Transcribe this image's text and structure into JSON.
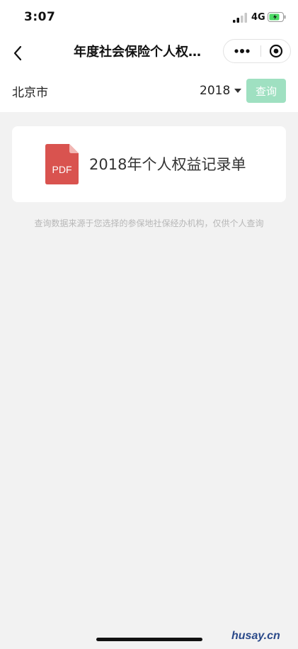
{
  "status_bar": {
    "time": "3:07",
    "network": "4G",
    "battery_color": "#4cd964"
  },
  "nav": {
    "title": "年度社会保险个人权…"
  },
  "filter": {
    "city": "北京市",
    "year": "2018",
    "query_label": "查询",
    "query_color": "#9fe0c1"
  },
  "record": {
    "icon_label": "PDF",
    "icon_color": "#d9534f",
    "title": "2018年个人权益记录单"
  },
  "note": "查询数据来源于您选择的参保地社保经办机构，仅供个人查询",
  "watermark": "husay.cn"
}
